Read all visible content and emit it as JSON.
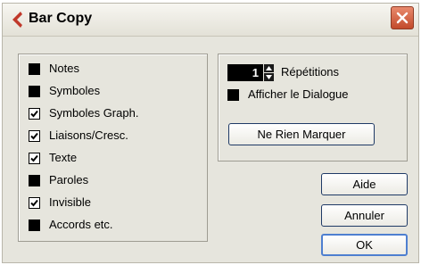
{
  "window": {
    "title": "Bar Copy",
    "accent_color": "#c0392b",
    "close_icon": "close-icon"
  },
  "options": [
    {
      "label": "Notes",
      "checked": false
    },
    {
      "label": "Symboles",
      "checked": false
    },
    {
      "label": "Symboles Graph.",
      "checked": true
    },
    {
      "label": "Liaisons/Cresc.",
      "checked": true
    },
    {
      "label": "Texte",
      "checked": true
    },
    {
      "label": "Paroles",
      "checked": false
    },
    {
      "label": "Invisible",
      "checked": true
    },
    {
      "label": "Accords etc.",
      "checked": false
    }
  ],
  "repeat": {
    "value": "1",
    "label": "Répétitions"
  },
  "show_dialog": {
    "label": "Afficher le Dialogue",
    "checked": false
  },
  "buttons": {
    "unmark": "Ne Rien Marquer",
    "help": "Aide",
    "cancel": "Annuler",
    "ok": "OK"
  }
}
